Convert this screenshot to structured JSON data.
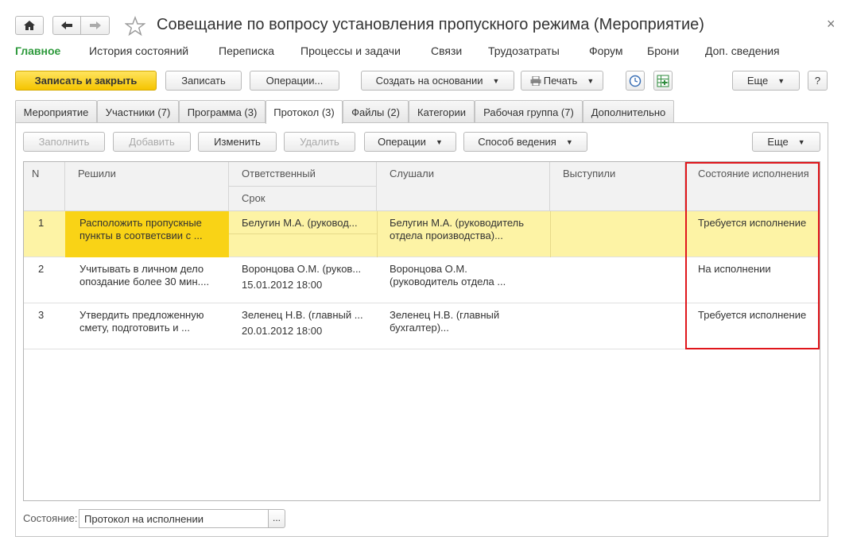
{
  "window": {
    "title": "Совещание по вопросу установления пропускного режима (Мероприятие)",
    "close_glyph": "×"
  },
  "nav": {
    "home_icon": "home-icon",
    "back_icon": "arrow-left-icon",
    "forward_icon": "arrow-right-icon",
    "star_icon": "star-icon"
  },
  "menu": {
    "items": [
      "Главное",
      "История состояний",
      "Переписка",
      "Процессы и задачи",
      "Связи",
      "Трудозатраты",
      "Форум",
      "Брони",
      "Доп. сведения"
    ],
    "active_color": "#2e9a3c"
  },
  "toolbar": {
    "save_close": "Записать и закрыть",
    "save": "Записать",
    "operations": "Операции...",
    "create_based": "Создать на основании",
    "print": "Печать",
    "more": "Еще",
    "help": "?"
  },
  "tabs": [
    "Мероприятие",
    "Участники (7)",
    "Программа (3)",
    "Протокол (3)",
    "Файлы (2)",
    "Категории",
    "Рабочая группа (7)",
    "Дополнительно"
  ],
  "active_tab": "Протокол (3)",
  "table_toolbar": {
    "fill": "Заполнить",
    "add": "Добавить",
    "edit": "Изменить",
    "delete": "Удалить",
    "operations": "Операции",
    "method": "Способ ведения",
    "more": "Еще"
  },
  "table": {
    "headers": {
      "n": "N",
      "decided": "Решили",
      "responsible": "Ответственный",
      "deadline": "Срок",
      "heard": "Слушали",
      "spoke": "Выступили",
      "status": "Состояние исполнения"
    },
    "rows": [
      {
        "n": "1",
        "decided": [
          "Расположить пропускные",
          "пункты в соответсвии с ..."
        ],
        "responsible": "Белугин М.А. (руковод...",
        "deadline": "",
        "heard": [
          "Белугин М.А. (руководитель",
          "отдела производства)..."
        ],
        "spoke": "",
        "status": "Требуется исполнение"
      },
      {
        "n": "2",
        "decided": [
          "Учитывать в личном дело",
          "опоздание более 30 мин...."
        ],
        "responsible": "Воронцова О.М. (руков...",
        "deadline": "15.01.2012 18:00",
        "heard": [
          "Воронцова О.М.",
          "(руководитель отдела ..."
        ],
        "spoke": "",
        "status": "На исполнении"
      },
      {
        "n": "3",
        "decided": [
          "Утвердить предложенную",
          "смету, подготовить и ..."
        ],
        "responsible": "Зеленец Н.В. (главный ...",
        "deadline": "20.01.2012 18:00",
        "heard": [
          "Зеленец Н.В. (главный",
          "бухгалтер)..."
        ],
        "spoke": "",
        "status": "Требуется исполнение"
      }
    ],
    "selected_row_color": "#fdf3a5",
    "selected_cell_color": "#f9d316"
  },
  "footer": {
    "status_label": "Состояние:",
    "status_value": "Протокол на исполнении",
    "ellipsis": "..."
  },
  "highlight_color": "#e0161b"
}
